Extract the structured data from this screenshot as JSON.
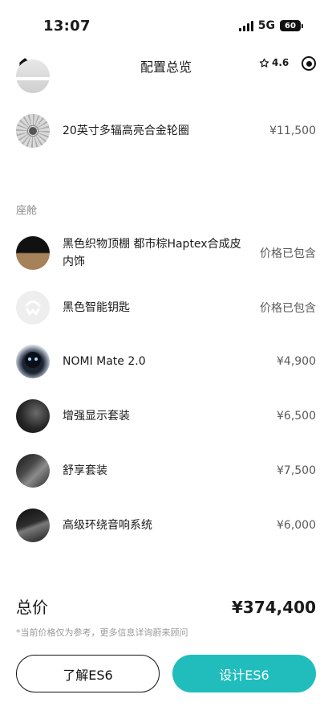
{
  "status_bar": {
    "time": "13:07",
    "network": "5G",
    "battery": "60"
  },
  "nav": {
    "title": "配置总览",
    "rating": "4.6",
    "icons": [
      "home-icon",
      "star-outline-icon",
      "target-icon"
    ]
  },
  "items": [
    {
      "name": "20英寸多辐高亮合金轮圈",
      "price": "¥11,500",
      "thumb": "wheel"
    }
  ],
  "cockpit": {
    "title": "座舱",
    "items": [
      {
        "name": "黑色织物顶棚 都市棕Haptex合成皮内饰",
        "price": "价格已包含",
        "thumb": "headliner"
      },
      {
        "name": "黑色智能钥匙",
        "price": "价格已包含",
        "thumb": "key"
      },
      {
        "name": "NOMI Mate 2.0",
        "price": "¥4,900",
        "thumb": "nomi"
      },
      {
        "name": "增强显示套装",
        "price": "¥6,500",
        "thumb": "display"
      },
      {
        "name": "舒享套装",
        "price": "¥7,500",
        "thumb": "seat"
      },
      {
        "name": "高级环绕音响系统",
        "price": "¥6,000",
        "thumb": "audio"
      }
    ]
  },
  "summary": {
    "total_label": "总价",
    "total_value": "¥374,400",
    "disclaimer": "*当前价格仅为参考，更多信息详询蔚来顾问"
  },
  "actions": {
    "learn_label": "了解ES6",
    "design_label": "设计ES6"
  },
  "colors": {
    "accent": "#21bdbd",
    "text": "#1a1a1a",
    "muted": "#8a8a8a"
  }
}
